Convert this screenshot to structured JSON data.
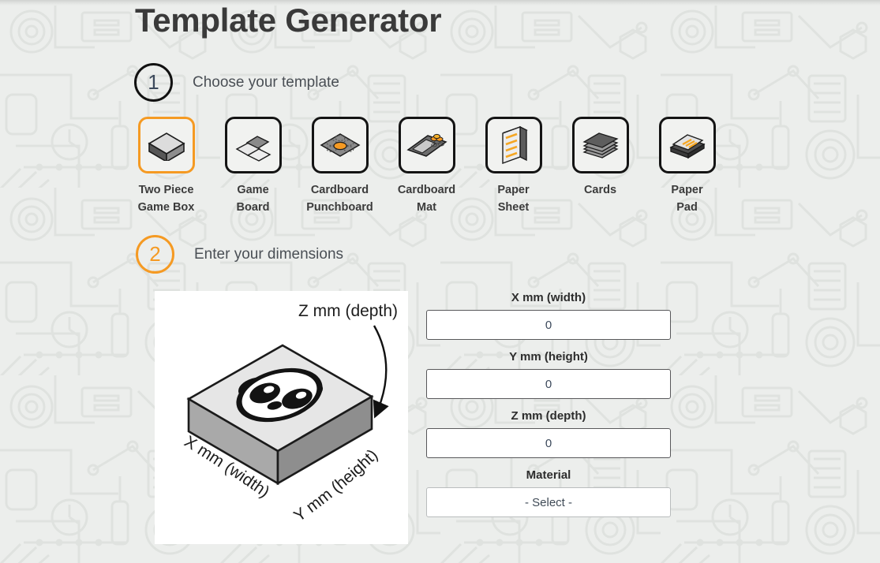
{
  "page": {
    "title": "Template Generator",
    "accent_color": "#f59a23",
    "background_color": "#eceeec",
    "text_color": "#3a3a3a"
  },
  "steps": [
    {
      "number": "1",
      "label": "Choose your template",
      "state": "dark"
    },
    {
      "number": "2",
      "label": "Enter your dimensions",
      "state": "accent"
    }
  ],
  "templates": [
    {
      "id": "two-piece-game-box",
      "line1": "Two Piece",
      "line2": "Game Box",
      "icon": "box-icon",
      "selected": true
    },
    {
      "id": "game-board",
      "line1": "Game",
      "line2": "Board",
      "icon": "game-board-icon",
      "selected": false
    },
    {
      "id": "cardboard-punchboard",
      "line1": "Cardboard",
      "line2": "Punchboard",
      "icon": "punchboard-icon",
      "selected": false
    },
    {
      "id": "cardboard-mat",
      "line1": "Cardboard",
      "line2": "Mat",
      "icon": "mat-icon",
      "selected": false
    },
    {
      "id": "paper-sheet",
      "line1": "Paper",
      "line2": "Sheet",
      "icon": "paper-sheet-icon",
      "selected": false
    },
    {
      "id": "cards",
      "line1": "Cards",
      "line2": "",
      "icon": "cards-icon",
      "selected": false
    },
    {
      "id": "paper-pad",
      "line1": "Paper",
      "line2": "Pad",
      "icon": "paper-pad-icon",
      "selected": false
    }
  ],
  "illustration": {
    "name": "two-piece-game-box-diagram",
    "logo": "panda-logo",
    "label_x": "X mm (width)",
    "label_y": "Y mm (height)",
    "label_z": "Z mm (depth)"
  },
  "form": {
    "x": {
      "label": "X mm (width)",
      "value": "0",
      "placeholder": "0"
    },
    "y": {
      "label": "Y mm (height)",
      "value": "0",
      "placeholder": "0"
    },
    "z": {
      "label": "Z mm (depth)",
      "value": "0",
      "placeholder": "0"
    },
    "material": {
      "label": "Material",
      "value": "- Select -",
      "options": [
        "- Select -"
      ]
    }
  }
}
